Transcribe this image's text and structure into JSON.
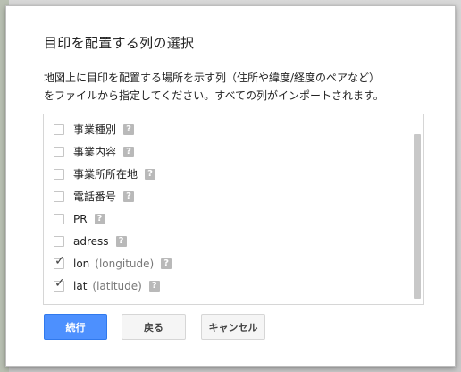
{
  "dialog": {
    "title": "目印を配置する列の選択",
    "description_lines": [
      "地図上に目印を配置する場所を示す列（住所や緯度/経度のペアなど）",
      "をファイルから指定してください。すべての列がインポートされます。"
    ]
  },
  "columns": [
    {
      "label": "事業種別",
      "sub": "",
      "checked": false,
      "help": "?"
    },
    {
      "label": "事業内容",
      "sub": "",
      "checked": false,
      "help": "?"
    },
    {
      "label": "事業所所在地",
      "sub": "",
      "checked": false,
      "help": "?"
    },
    {
      "label": "電話番号",
      "sub": "",
      "checked": false,
      "help": "?"
    },
    {
      "label": "PR",
      "sub": "",
      "checked": false,
      "help": "?"
    },
    {
      "label": "adress",
      "sub": "",
      "checked": false,
      "help": "?"
    },
    {
      "label": "lon",
      "sub": "(longitude)",
      "checked": true,
      "help": "?"
    },
    {
      "label": "lat",
      "sub": "(latitude)",
      "checked": true,
      "help": "?"
    }
  ],
  "buttons": {
    "continue_label": "続行",
    "back_label": "戻る",
    "cancel_label": "キャンセル"
  },
  "colors": {
    "primary": "#4d90fe",
    "help_badge": "#b9b9b9",
    "scrollbar": "#c8c8c8"
  }
}
